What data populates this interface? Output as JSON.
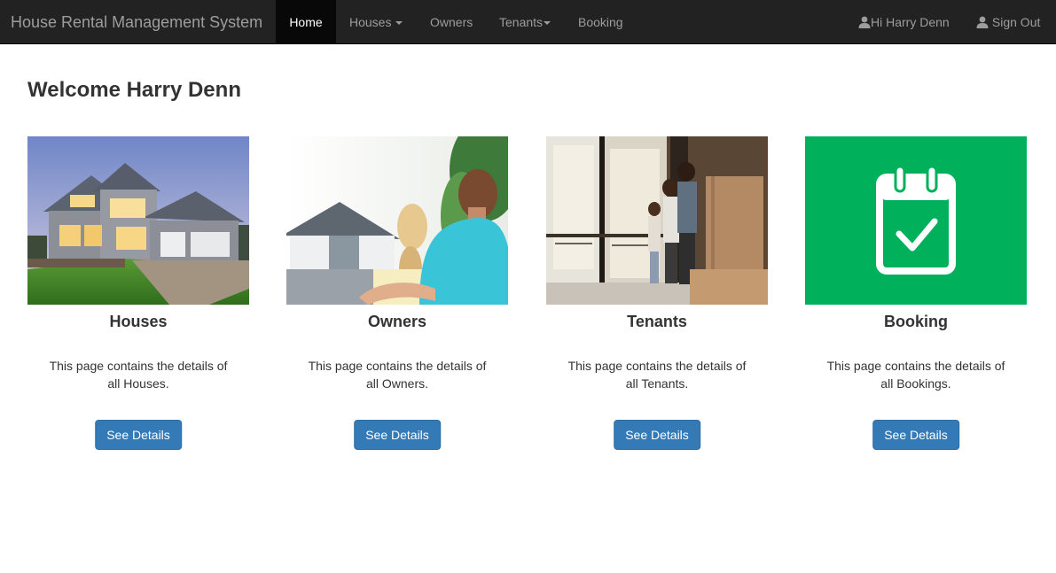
{
  "navbar": {
    "brand": "House Rental Management System",
    "items": [
      {
        "label": "Home",
        "active": true
      },
      {
        "label": "Houses",
        "dropdown": true
      },
      {
        "label": "Owners"
      },
      {
        "label": "Tenants",
        "dropdown": true
      },
      {
        "label": "Booking"
      }
    ],
    "user_greeting": "Hi Harry Denn",
    "sign_out": "Sign Out"
  },
  "main": {
    "welcome": "Welcome Harry Denn",
    "cards": [
      {
        "title": "Houses",
        "text": "This page contains the details of all Houses.",
        "button": "See Details",
        "image": "house-exterior-photo"
      },
      {
        "title": "Owners",
        "text": "This page contains the details of all Owners.",
        "button": "See Details",
        "image": "couple-looking-at-house-photo"
      },
      {
        "title": "Tenants",
        "text": "This page contains the details of all Tenants.",
        "button": "See Details",
        "image": "family-at-window-photo"
      },
      {
        "title": "Booking",
        "text": "This page contains the details of all Bookings.",
        "button": "See Details",
        "image": "calendar-check-icon"
      }
    ]
  },
  "colors": {
    "navbar_bg": "#222222",
    "nav_active_bg": "#080808",
    "nav_text": "#9d9d9d",
    "button_primary": "#337ab7",
    "booking_tile": "#00b05a"
  }
}
